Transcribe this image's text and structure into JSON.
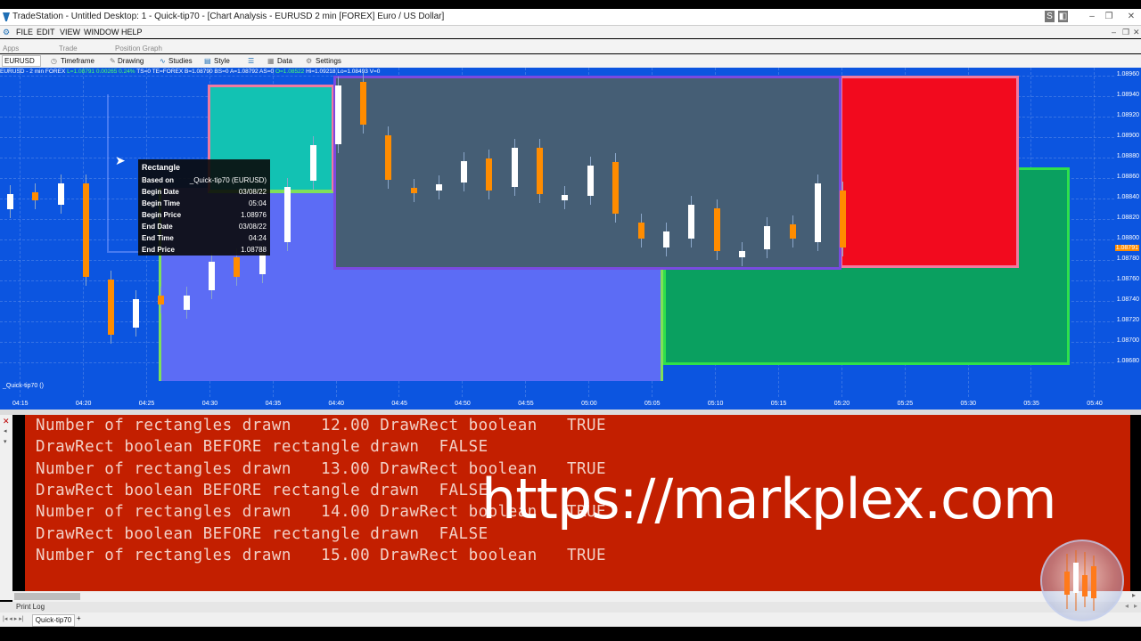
{
  "window": {
    "title": "TradeStation - Untitled Desktop: 1 - Quick-tip70 - [Chart Analysis - EURUSD 2 min [FOREX] Euro / US Dollar]"
  },
  "menu": [
    "FILE",
    "EDIT",
    "VIEW",
    "WINDOW",
    "HELP"
  ],
  "subbar": [
    "Apps",
    "Trade",
    "Position Graph"
  ],
  "toolbar": {
    "symbol": "EURUSD",
    "items": [
      "Timeframe",
      "Drawing",
      "Studies",
      "Style",
      "Data",
      "Settings"
    ]
  },
  "status_line": {
    "prefix": "EURUSD - 2 min  FOREX",
    "last": "L=1.08791  0.00265  0.24%",
    "rest": "TS=0  TE=FOREX  B=1.08790  BS=0  A=1.08792  AS=0",
    "open": "O=1.08522",
    "hilo": "Hi=1.09218  Lo=1.08493  V=0"
  },
  "indicator_label": "_Quick-tip70 ()",
  "price_axis": [
    "1.08960",
    "1.08940",
    "1.08920",
    "1.08900",
    "1.08880",
    "1.08860",
    "1.08840",
    "1.08820",
    "1.08800",
    "1.08780",
    "1.08760",
    "1.08740",
    "1.08720",
    "1.08700",
    "1.08680"
  ],
  "current_price_label": "1.08791",
  "time_axis": [
    "04:15",
    "04:20",
    "04:25",
    "04:30",
    "04:35",
    "04:40",
    "04:45",
    "04:50",
    "04:55",
    "05:00",
    "05:05",
    "05:10",
    "05:15",
    "05:20",
    "05:25",
    "05:30",
    "05:35",
    "05:40"
  ],
  "rect_colors": {
    "teal": "#12c2b3",
    "slate": "#455e75",
    "red": "#f20a1e",
    "green": "#0aa060",
    "periwinkle": "#5c6cf5"
  },
  "candle_colors": {
    "up": "#ffffff",
    "down": "#ff8c00"
  },
  "tooltip": {
    "title": "Rectangle",
    "rows": [
      {
        "key": "Based on",
        "value": "_Quick-tip70 (EURUSD)"
      },
      {
        "key": "Begin Date",
        "value": "03/08/22"
      },
      {
        "key": "Begin Time",
        "value": "05:04"
      },
      {
        "key": "Begin Price",
        "value": "1.08976"
      },
      {
        "key": "End Date",
        "value": "03/08/22"
      },
      {
        "key": "End Time",
        "value": "04:24"
      },
      {
        "key": "End Price",
        "value": "1.08788"
      }
    ]
  },
  "log_lines": [
    "Number of rectangles drawn   12.00 DrawRect boolean   TRUE",
    "DrawRect boolean BEFORE rectangle drawn  FALSE",
    "Number of rectangles drawn   13.00 DrawRect boolean   TRUE",
    "DrawRect boolean BEFORE rectangle drawn  FALSE",
    "Number of rectangles drawn   14.00 DrawRect boolean   TRUE",
    "DrawRect boolean BEFORE rectangle drawn  FALSE",
    "Number of rectangles drawn   15.00 DrawRect boolean   TRUE"
  ],
  "watermark": "https://markplex.com",
  "print_log_label": "Print Log",
  "bottom_tab": "Quick-tip70",
  "bottom_tab_add": "+"
}
